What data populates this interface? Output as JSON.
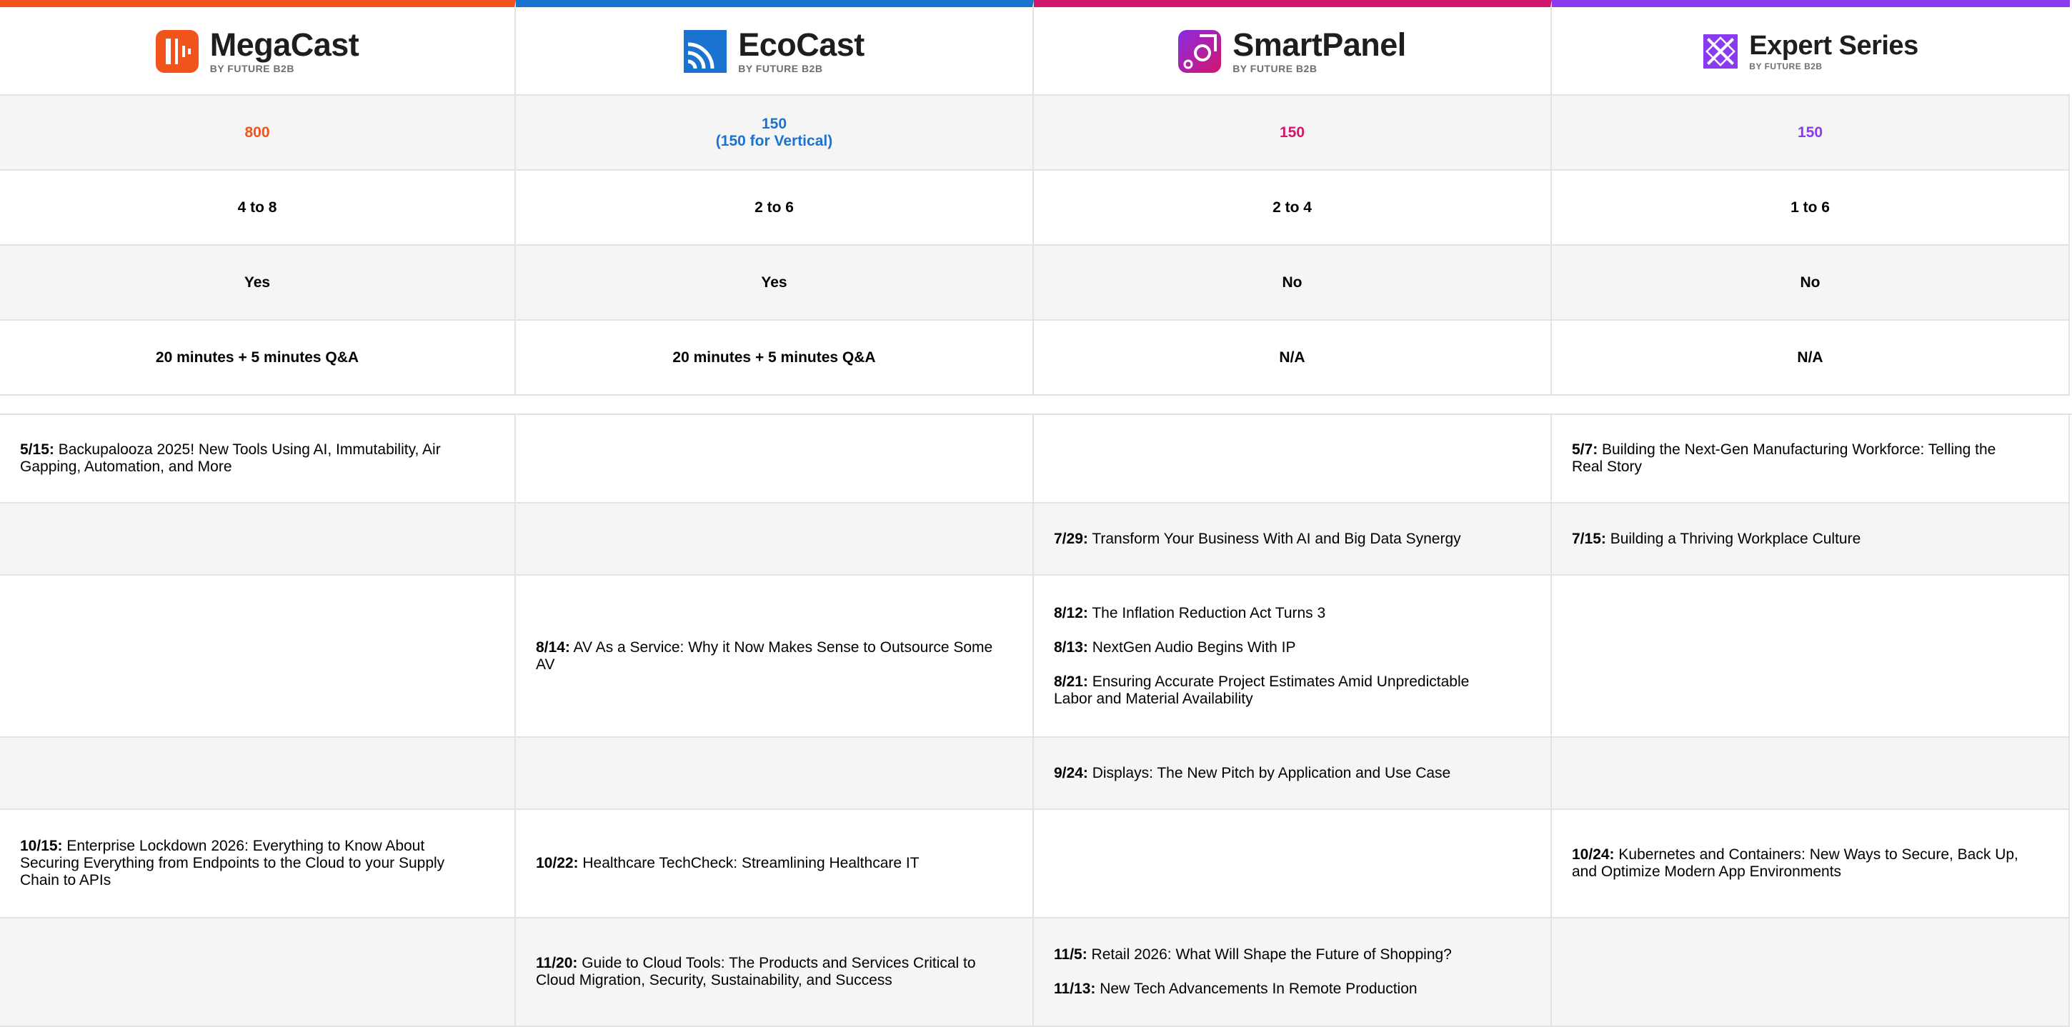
{
  "brands": [
    {
      "name": "MegaCast",
      "sub": "BY FUTURE B2B",
      "color": "#f2531c",
      "icon": "megacast-logo-icon"
    },
    {
      "name": "EcoCast",
      "sub": "BY FUTURE B2B",
      "color": "#1a73d0",
      "icon": "ecocast-logo-icon"
    },
    {
      "name": "SmartPanel",
      "sub": "BY FUTURE B2B",
      "color": "#d1166d",
      "icon": "smartpanel-logo-icon"
    },
    {
      "name": "Expert Series",
      "sub": "BY FUTURE B2B",
      "color": "#8a3bf0",
      "icon": "expert-series-logo-icon"
    }
  ],
  "stats": {
    "leads": {
      "megacast": "800",
      "ecocast_1": "150",
      "ecocast_2": "(150 for Vertical)",
      "smartpanel": "150",
      "expert": "150"
    },
    "speakers": {
      "megacast": "4 to 8",
      "ecocast": "2 to 6",
      "smartpanel": "2 to 4",
      "expert": "1 to 6"
    },
    "presentation": {
      "megacast": "Yes",
      "ecocast": "Yes",
      "smartpanel": "No",
      "expert": "No"
    },
    "format": {
      "megacast": "20 minutes  + 5 minutes Q&A",
      "ecocast": "20 minutes  + 5 minutes Q&A",
      "smartpanel": "N/A",
      "expert": "N/A"
    }
  },
  "schedule": {
    "r1": {
      "megacast": [
        {
          "date": "5/15:",
          "title": "Backupalooza 2025! New Tools Using AI, Immutability, Air Gapping, Automation, and More"
        }
      ],
      "expert": [
        {
          "date": "5/7:",
          "title": "Building the Next-Gen Manufacturing Workforce: Telling the Real Story"
        }
      ]
    },
    "r2": {
      "smartpanel": [
        {
          "date": "7/29:",
          "title": "Transform Your Business With AI and Big Data Synergy"
        }
      ],
      "expert": [
        {
          "date": "7/15:",
          "title": "Building a Thriving Workplace Culture"
        }
      ]
    },
    "r3": {
      "ecocast": [
        {
          "date": "8/14:",
          "title": "AV As a Service: Why it Now Makes Sense to Outsource Some AV"
        }
      ],
      "smartpanel": [
        {
          "date": "8/12:",
          "title": "The Inflation Reduction Act Turns 3"
        },
        {
          "date": "8/13:",
          "title": "NextGen Audio Begins With IP"
        },
        {
          "date": "8/21:",
          "title": "Ensuring Accurate Project Estimates Amid Unpredictable Labor and Material Availability"
        }
      ]
    },
    "r4": {
      "smartpanel": [
        {
          "date": "9/24:",
          "title": "Displays: The New Pitch by Application and Use Case"
        }
      ]
    },
    "r5": {
      "megacast": [
        {
          "date": "10/15:",
          "title": "Enterprise Lockdown 2026: Everything to Know About Securing Everything from Endpoints to the Cloud to your Supply Chain to APIs"
        }
      ],
      "ecocast": [
        {
          "date": "10/22:",
          "title": "Healthcare TechCheck: Streamlining Healthcare IT"
        }
      ],
      "expert": [
        {
          "date": "10/24:",
          "title": "Kubernetes and Containers: New Ways to Secure, Back Up, and Optimize Modern App Environments"
        }
      ]
    },
    "r6": {
      "ecocast": [
        {
          "date": "11/20:",
          "title": "Guide to Cloud Tools: The Products and Services Critical to Cloud Migration, Security, Sustainability, and Success"
        }
      ],
      "smartpanel": [
        {
          "date": "11/5:",
          "title": "Retail 2026: What Will Shape the Future of Shopping?"
        },
        {
          "date": "11/13:",
          "title": "New Tech Advancements In Remote Production"
        }
      ]
    }
  }
}
